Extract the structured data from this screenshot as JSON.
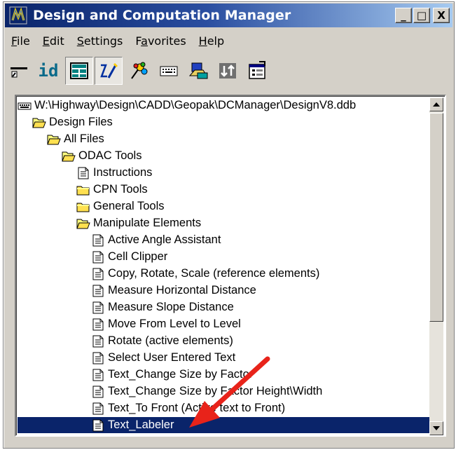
{
  "window": {
    "title": "Design and Computation Manager"
  },
  "title_buttons": [
    "_",
    "□",
    "X"
  ],
  "menu": [
    {
      "label": "File",
      "u": "F",
      "rest": "ile"
    },
    {
      "label": "Edit",
      "u": "E",
      "rest": "dit"
    },
    {
      "label": "Settings",
      "u": "S",
      "rest": "ettings"
    },
    {
      "label": "Favorites",
      "pre": "F",
      "u": "a",
      "rest": "vorites"
    },
    {
      "label": "Help",
      "u": "H",
      "rest": "elp"
    }
  ],
  "toolbar": {
    "id_label": "id",
    "tools": [
      "path-tool-icon",
      "id-tool-icon",
      "list-view-icon",
      "edit-mode-icon",
      "palette-icon",
      "keyboard-icon",
      "cell-library-icon",
      "run-icon",
      "properties-icon"
    ]
  },
  "tree": {
    "items": [
      {
        "label": "W:\\Highway\\Design\\CADD\\Geopak\\DCManager\\DesignV8.ddb",
        "icon": "database-icon",
        "level": 0
      },
      {
        "label": "Design Files",
        "icon": "folder-open-icon",
        "level": 1
      },
      {
        "label": "All Files",
        "icon": "folder-open-icon",
        "level": 2
      },
      {
        "label": "ODAC Tools",
        "icon": "folder-open-icon",
        "level": 3
      },
      {
        "label": "Instructions",
        "icon": "document-icon",
        "level": 4
      },
      {
        "label": "CPN Tools",
        "icon": "folder-closed-icon",
        "level": 4
      },
      {
        "label": "General Tools",
        "icon": "folder-closed-icon",
        "level": 4
      },
      {
        "label": "Manipulate Elements",
        "icon": "folder-open-icon",
        "level": 4
      },
      {
        "label": "Active Angle Assistant",
        "icon": "document-icon",
        "level": 5
      },
      {
        "label": "Cell Clipper",
        "icon": "document-icon",
        "level": 5
      },
      {
        "label": "Copy, Rotate, Scale (reference elements)",
        "icon": "document-icon",
        "level": 5
      },
      {
        "label": "Measure Horizontal Distance",
        "icon": "document-icon",
        "level": 5
      },
      {
        "label": "Measure Slope Distance",
        "icon": "document-icon",
        "level": 5
      },
      {
        "label": "Move From Level to Level",
        "icon": "document-icon",
        "level": 5
      },
      {
        "label": "Rotate (active elements)",
        "icon": "document-icon",
        "level": 5
      },
      {
        "label": "Select User Entered Text",
        "icon": "document-icon",
        "level": 5
      },
      {
        "label": "Text_Change Size by Factor",
        "icon": "document-icon",
        "level": 5
      },
      {
        "label": "Text_Change Size by Factor Height\\Width",
        "icon": "document-icon",
        "level": 5
      },
      {
        "label": "Text_To Front (Active text to Front)",
        "icon": "document-icon",
        "level": 5
      },
      {
        "label": "Text_Labeler",
        "icon": "document-icon",
        "level": 5,
        "selected": true
      }
    ]
  },
  "colors": {
    "selection": "#0a246a",
    "arrow": "#e8231a",
    "title_start": "#0a246a",
    "title_end": "#a6caf0"
  }
}
